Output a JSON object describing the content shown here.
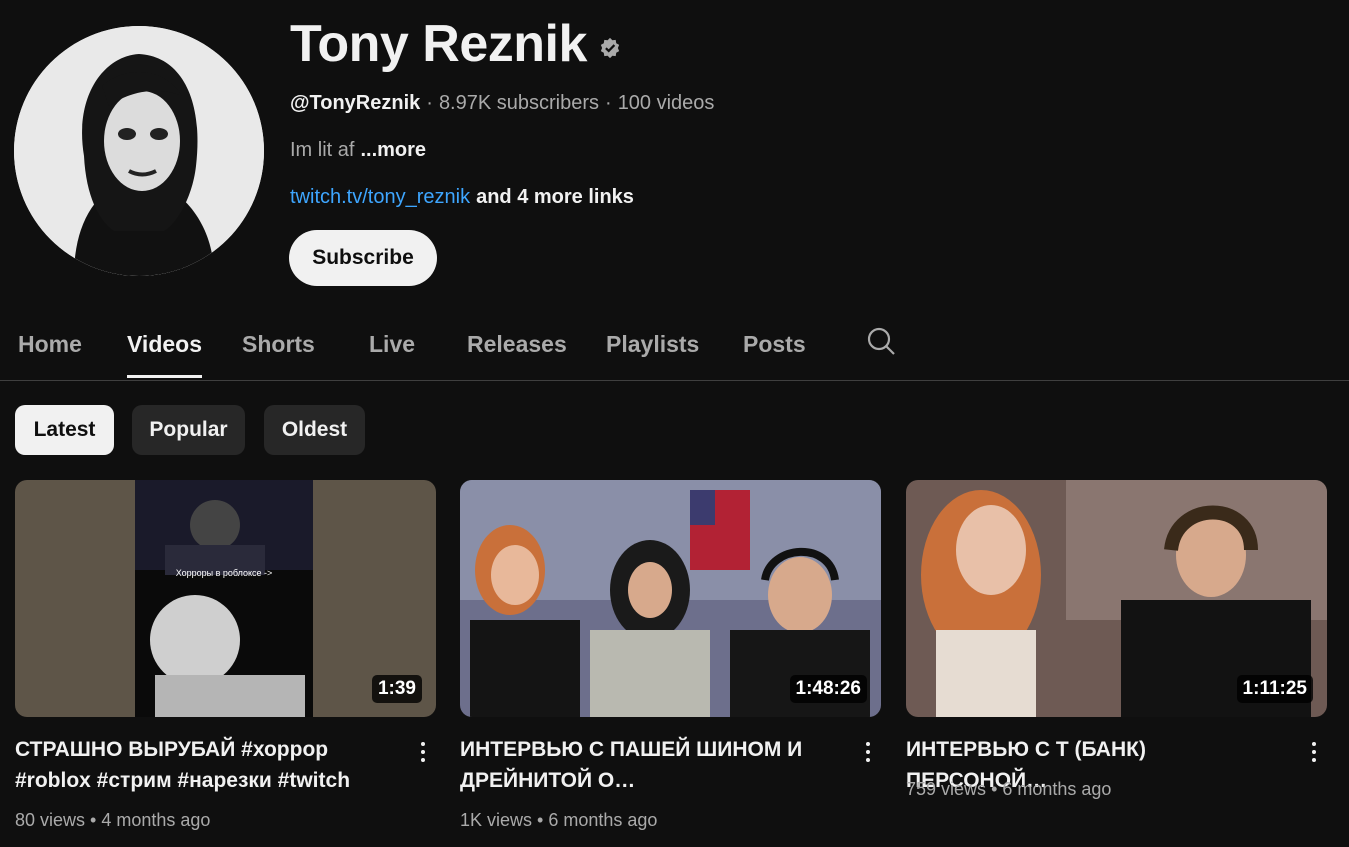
{
  "channel": {
    "name": "Tony Reznik",
    "handle": "@TonyReznik",
    "subscribers": "8.97K subscribers",
    "videos_count": "100 videos",
    "meta_separator": "·",
    "description": "Im lit af",
    "more_label": "...more",
    "link_text": "twitch.tv/tony_reznik",
    "more_links_label": "and 4 more links",
    "subscribe_label": "Subscribe"
  },
  "tabs": [
    {
      "label": "Home",
      "active": false
    },
    {
      "label": "Videos",
      "active": true
    },
    {
      "label": "Shorts",
      "active": false
    },
    {
      "label": "Live",
      "active": false
    },
    {
      "label": "Releases",
      "active": false
    },
    {
      "label": "Playlists",
      "active": false
    },
    {
      "label": "Posts",
      "active": false
    }
  ],
  "chips": [
    {
      "label": "Latest",
      "selected": true
    },
    {
      "label": "Popular",
      "selected": false
    },
    {
      "label": "Oldest",
      "selected": false
    }
  ],
  "videos": [
    {
      "title": "СТРАШНО ВЫРУБАЙ #хоррор #roblox #стрим #нарезки #twitch",
      "duration": "1:39",
      "views": "80 views",
      "age": "4 months ago",
      "thumb_caption": "Хорроры в роблоксе ->"
    },
    {
      "title": "ИНТЕРВЬЮ С ПАШЕЙ ШИНОМ И ДРЕЙНИТОЙ О РАЗНОВИДНОСТЯХ…",
      "duration": "1:48:26",
      "views": "1K views",
      "age": "6 months ago"
    },
    {
      "title": "ИНТЕРВЬЮ С Т (БАНК) ПЕРСОНОЙ…",
      "duration": "1:11:25",
      "views": "759 views",
      "age": "6 months ago"
    }
  ],
  "icons": {
    "verified": "verified-badge-icon",
    "search": "search-icon",
    "menu": "more-vertical-icon"
  },
  "colors": {
    "background": "#0f0f0f",
    "link": "#3ea6ff",
    "text_secondary": "#aaaaaa"
  }
}
